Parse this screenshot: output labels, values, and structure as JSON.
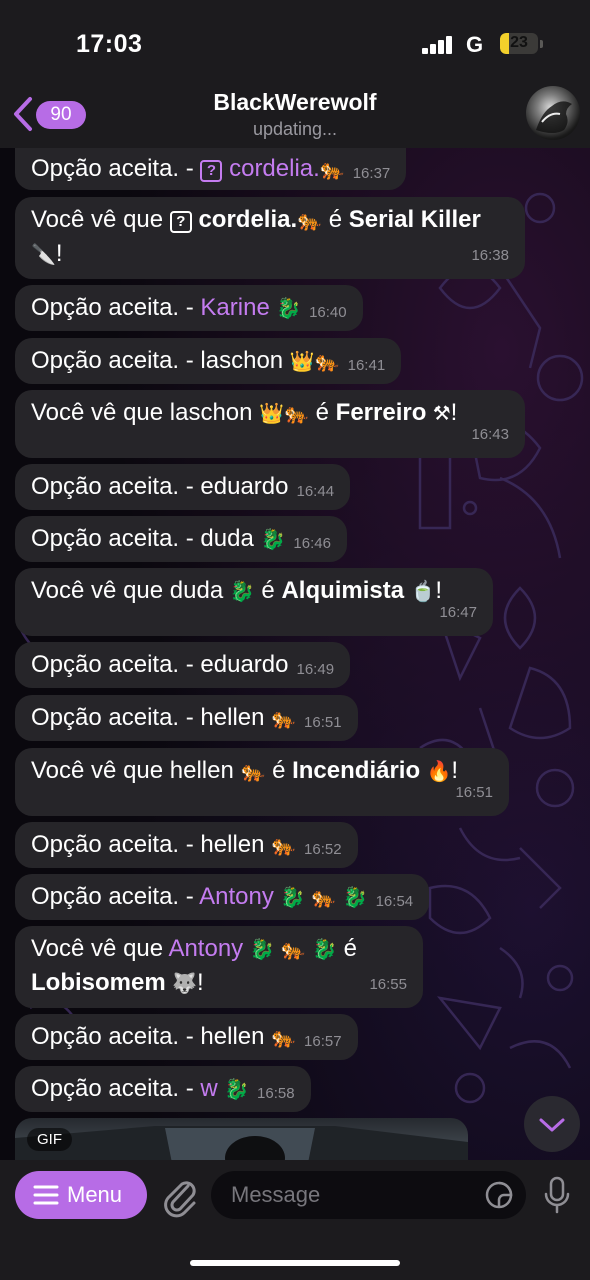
{
  "status_bar": {
    "time": "17:03",
    "carrier": "G",
    "battery": "23",
    "battery_level": 0.23
  },
  "header": {
    "back_count": "90",
    "title": "BlackWerewolf",
    "subtitle": "updating..."
  },
  "messages": [
    {
      "parts": [
        "Opção aceita. - ",
        "?",
        " cordelia.",
        "🐅"
      ],
      "time": "16:37"
    },
    {
      "parts": [
        "Você vê que ",
        "?",
        " cordelia.",
        "🐅",
        " é ",
        "Serial Killer",
        "🔪",
        "!"
      ],
      "time": "16:38"
    },
    {
      "parts": [
        "Opção aceita. - ",
        "Karine",
        " 🐉"
      ],
      "time": "16:40"
    },
    {
      "parts": [
        "Opção aceita. - laschon ",
        "👑🐅"
      ],
      "time": "16:41"
    },
    {
      "parts": [
        "Você vê que laschon ",
        "👑🐅",
        " é ",
        "Ferreiro",
        " ⚒",
        "!"
      ],
      "time": "16:43"
    },
    {
      "parts": [
        "Opção aceita. - eduardo"
      ],
      "time": "16:44"
    },
    {
      "parts": [
        "Opção aceita. - duda ",
        "🐉"
      ],
      "time": "16:46"
    },
    {
      "parts": [
        "Você vê que duda ",
        "🐉",
        " é ",
        "Alquimista",
        " 🍵",
        "!"
      ],
      "time": "16:47"
    },
    {
      "parts": [
        "Opção aceita. - eduardo"
      ],
      "time": "16:49"
    },
    {
      "parts": [
        "Opção aceita. - hellen ",
        "🐅"
      ],
      "time": "16:51"
    },
    {
      "parts": [
        "Você vê que hellen ",
        "🐅",
        " é ",
        "Incendiário",
        " 🔥",
        "!"
      ],
      "time": "16:51"
    },
    {
      "parts": [
        "Opção aceita. - hellen ",
        "🐅"
      ],
      "time": "16:52"
    },
    {
      "parts": [
        "Opção aceita. - ",
        "Antony",
        " 🐉 🐅 🐉"
      ],
      "time": "16:54"
    },
    {
      "parts": [
        "Você vê que ",
        "Antony",
        " 🐉 🐅 🐉",
        " é",
        "Lobisomem",
        " 🐺",
        "!"
      ],
      "time": "16:55"
    },
    {
      "parts": [
        "Opção aceita. - hellen ",
        "🐅"
      ],
      "time": "16:57"
    },
    {
      "parts": [
        "Opção aceita. - ",
        "w",
        " 🐉"
      ],
      "time": "16:58"
    }
  ],
  "gif_label": "GIF",
  "input": {
    "menu_label": "Menu",
    "placeholder": "Message"
  }
}
